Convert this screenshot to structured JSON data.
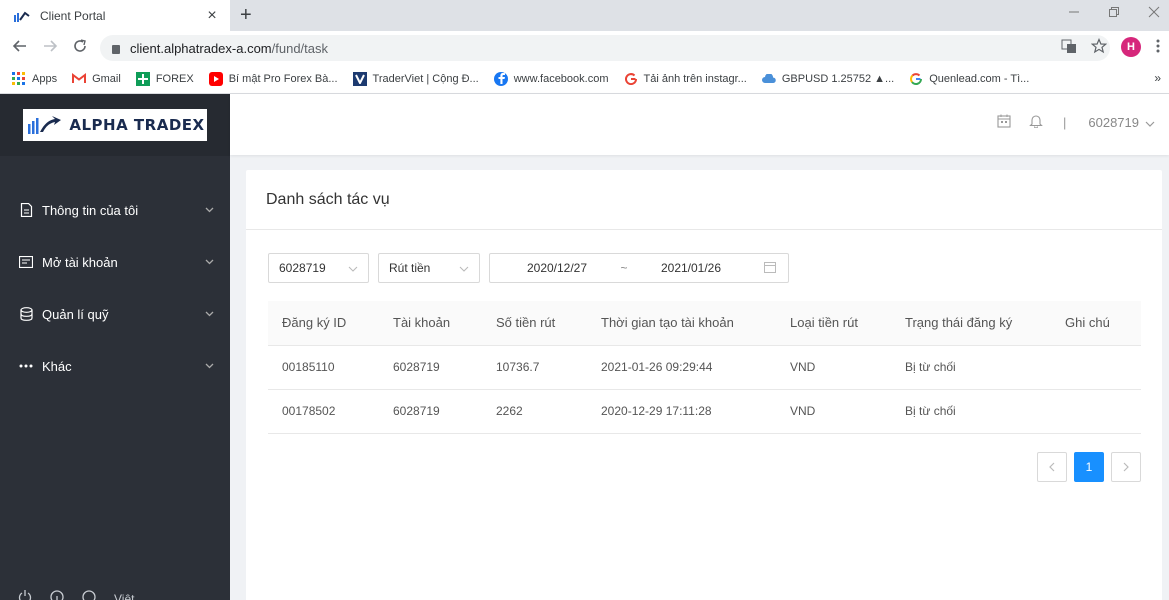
{
  "browser": {
    "tab_title": "Client Portal",
    "tab_close": "×",
    "new_tab": "+",
    "url_host": "client.alphatradex-a.com",
    "url_path": "/fund/task",
    "profile_initial": "H",
    "bookmarks": [
      {
        "label": "Apps",
        "icon": "apps-grid-icon"
      },
      {
        "label": "Gmail",
        "icon": "gmail-icon"
      },
      {
        "label": "FOREX",
        "icon": "forex-icon"
      },
      {
        "label": "Bí mật Pro Forex Bà...",
        "icon": "youtube-icon"
      },
      {
        "label": "TraderViet | Cộng Đ...",
        "icon": "traderviet-icon"
      },
      {
        "label": "www.facebook.com",
        "icon": "facebook-icon"
      },
      {
        "label": "Tải ảnh trên instagr...",
        "icon": "google-icon"
      },
      {
        "label": "GBPUSD 1.25752 ▲...",
        "icon": "cloud-icon"
      },
      {
        "label": "Quenlead.com - Tì...",
        "icon": "google-icon"
      }
    ],
    "more": "»"
  },
  "brand": {
    "name": "ALPHA TRADEX"
  },
  "sidebar": {
    "items": [
      {
        "label": "Thông tin của tôi",
        "icon": "document-icon"
      },
      {
        "label": "Mở tài khoản",
        "icon": "card-icon"
      },
      {
        "label": "Quản lí quỹ",
        "icon": "database-icon"
      },
      {
        "label": "Khác",
        "icon": "more-dots-icon"
      }
    ],
    "language": "Việt"
  },
  "header": {
    "separator": "|",
    "account": "6028719"
  },
  "page": {
    "title": "Danh sách tác vụ",
    "filters": {
      "account": "6028719",
      "type": "Rút tiền",
      "date_from": "2020/12/27",
      "date_sep": "~",
      "date_to": "2021/01/26"
    },
    "table": {
      "columns": [
        "Đăng ký ID",
        "Tài khoản",
        "Số tiền rút",
        "Thời gian tạo tài khoản",
        "Loại tiền rút",
        "Trạng thái đăng ký",
        "Ghi chú"
      ],
      "rows": [
        [
          "00185110",
          "6028719",
          "10736.7",
          "2021-01-26 09:29:44",
          "VND",
          "Bị từ chối",
          ""
        ],
        [
          "00178502",
          "6028719",
          "2262",
          "2020-12-29 17:11:28",
          "VND",
          "Bị từ chối",
          ""
        ]
      ]
    },
    "pagination": {
      "current": "1"
    }
  },
  "colors": {
    "sidebar": "#2c3038",
    "primary": "#1890ff"
  }
}
